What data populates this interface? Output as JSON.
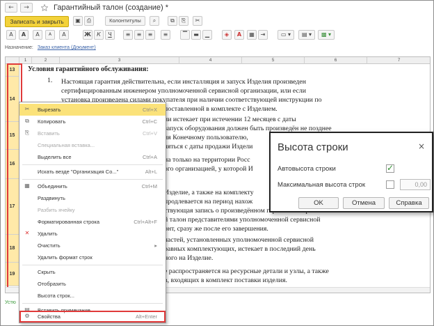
{
  "window": {
    "title": "Гарантийный талон (создание) *",
    "nav_back": "←",
    "nav_forward": "→"
  },
  "toolbar": {
    "save_close_label": "Записать и закрыть",
    "colontitles_label": "Колонтитулы"
  },
  "purpose": {
    "label": "Назначение:",
    "link": "Заказ клиента (Документ)"
  },
  "sheet": {
    "columns": [
      "1",
      "2",
      "3",
      "4",
      "5",
      "6",
      "7"
    ],
    "rows": [
      "13",
      "14",
      "15",
      "16",
      "17",
      "18",
      "19"
    ],
    "text_lines": [
      "Условия гарантийного обслуживания:",
      "1.",
      "Настоящая гарантия действительна, если инсталляция и запуск Изделия произведен",
      "сертифицированным инженером уполномоченной сервисной организации, или если",
      "установка произведена силами покупателя при наличии соответствующей инструкции по",
      "поставленной в комплекте с Изделием.",
      "ии истекает при истечении 12 месяцев с даты",
      "запуск оборудования должен быть произведён не позднее",
      "ия Конечному пользователю,",
      "ляться с даты продажи Издели",
      "на только на территории Росс",
      "ого организацией, у которой И",
      "Изделие, а также на комплекту",
      "продлевается на период нахож",
      "ствующая запись о произведённом гарантийном ремонте",
      "й талон представителями уполномоченной сервисной",
      "онт, сразу же после его завершения.",
      "частей, установленных уполномоченной сервисной",
      "равных комплектующих, истекает в последний день",
      "ного на Изделие.",
      "е распространяется на ресурсные детали и узлы, а также",
      "в, входящих в комплект поставки изделия."
    ]
  },
  "footer": {
    "text": "Устю"
  },
  "context_menu": {
    "items": [
      {
        "icon": "✂",
        "label": "Вырезать",
        "shortcut": "Ctrl+X",
        "disabled": false,
        "highlight": true
      },
      {
        "icon": "⧉",
        "label": "Копировать",
        "shortcut": "Ctrl+C",
        "disabled": false
      },
      {
        "icon": "⎘",
        "label": "Вставить",
        "shortcut": "Ctrl+V",
        "disabled": true
      },
      {
        "icon": "",
        "label": "Специальная вставка...",
        "shortcut": "",
        "disabled": true
      },
      {
        "icon": "",
        "label": "Выделить все",
        "shortcut": "Ctrl+A",
        "disabled": false
      },
      {
        "icon": "",
        "label": "Искать везде \"Организация Со...\"",
        "shortcut": "Alt+L",
        "disabled": false
      },
      {
        "icon": "▦",
        "label": "Объединить",
        "shortcut": "Ctrl+M",
        "disabled": false
      },
      {
        "icon": "",
        "label": "Раздвинуть",
        "shortcut": "",
        "disabled": false
      },
      {
        "icon": "",
        "label": "Разбить ячейку",
        "shortcut": "",
        "disabled": true
      },
      {
        "icon": "",
        "label": "Форматированная строка",
        "shortcut": "Ctrl+Alt+F",
        "disabled": false
      },
      {
        "icon": "✕",
        "label": "Удалить",
        "shortcut": "",
        "disabled": false
      },
      {
        "icon": "",
        "label": "Очистить",
        "shortcut": "▸",
        "disabled": false
      },
      {
        "icon": "",
        "label": "Удалить формат строк",
        "shortcut": "",
        "disabled": false
      },
      {
        "icon": "",
        "label": "Скрыть",
        "shortcut": "",
        "disabled": false
      },
      {
        "icon": "",
        "label": "Отобразить",
        "shortcut": "",
        "disabled": false
      },
      {
        "icon": "",
        "label": "Высота строк...",
        "shortcut": "",
        "disabled": false
      },
      {
        "icon": "▤",
        "label": "Вставить примечание",
        "shortcut": "",
        "disabled": false
      },
      {
        "icon": "⚙",
        "label": "Свойства",
        "shortcut": "Alt+Enter",
        "disabled": false,
        "boxed": true
      }
    ]
  },
  "dialog": {
    "title": "Высота строки",
    "close": "×",
    "auto_height_label": "Автовысота строки",
    "auto_height_checked": "✓",
    "max_height_label": "Максимальная высота строк",
    "max_height_value": "0,00",
    "ok_label": "OK",
    "cancel_label": "Отмена",
    "help_label": "Справка"
  },
  "colors": {
    "accent_yellow": "#f3d23a",
    "highlight_yellow": "#fbe27a",
    "frame_red": "#e03a3a",
    "check_green": "#2f8f2f",
    "link_blue": "#3b63a8"
  }
}
